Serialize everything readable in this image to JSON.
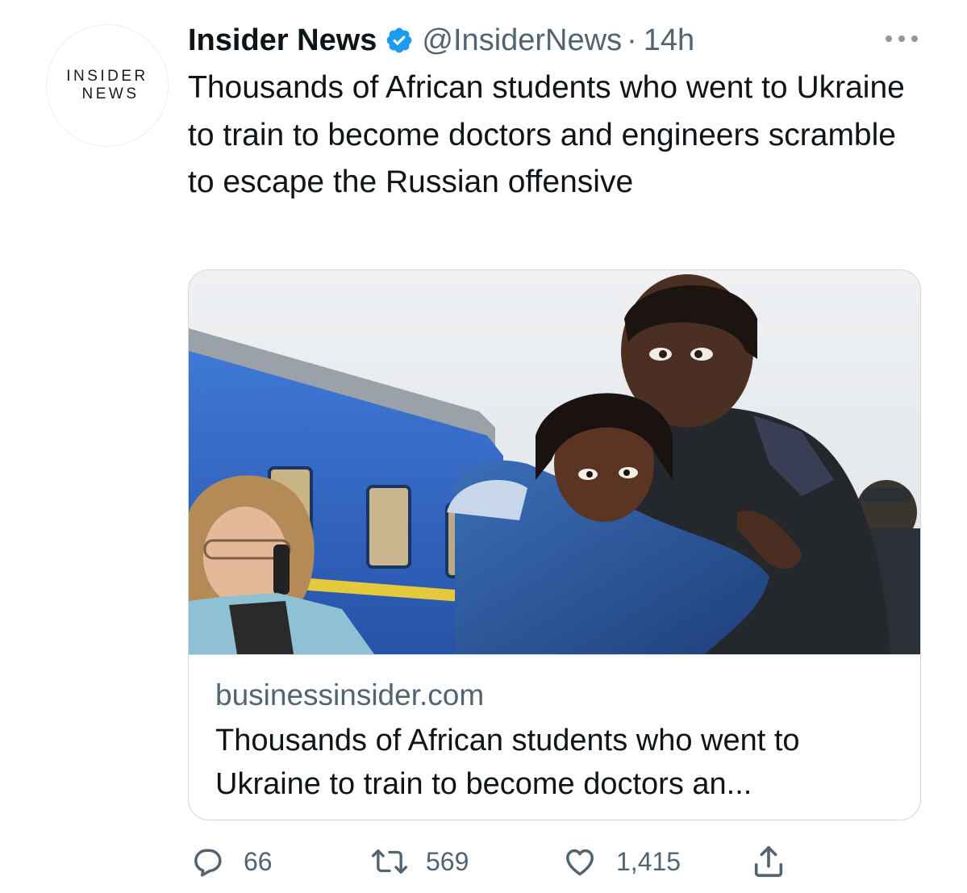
{
  "author": {
    "avatar_line1": "INSIDER",
    "avatar_line2": "NEWS",
    "display_name": "Insider News",
    "handle": "@InsiderNews",
    "separator": "·",
    "time": "14h",
    "verified": true
  },
  "tweet": {
    "text": "Thousands of African students who went to Ukraine to train to become doctors and engineers scramble to escape the Russian offensive"
  },
  "card": {
    "domain": "businessinsider.com",
    "title": "Thousands of African students who went to Ukraine to train to become doctors an..."
  },
  "actions": {
    "replies": "66",
    "retweets": "569",
    "likes": "1,415"
  },
  "colors": {
    "verified_badge": "#1d9bf0",
    "secondary_text": "#536471",
    "primary_text": "#0f1419",
    "border": "#cfd9de",
    "train_blue": "#2a63c4"
  },
  "icons": {
    "verified": "verified-badge-icon",
    "more": "more-options-icon",
    "reply": "reply-icon",
    "retweet": "retweet-icon",
    "like": "heart-icon",
    "share": "share-icon"
  }
}
